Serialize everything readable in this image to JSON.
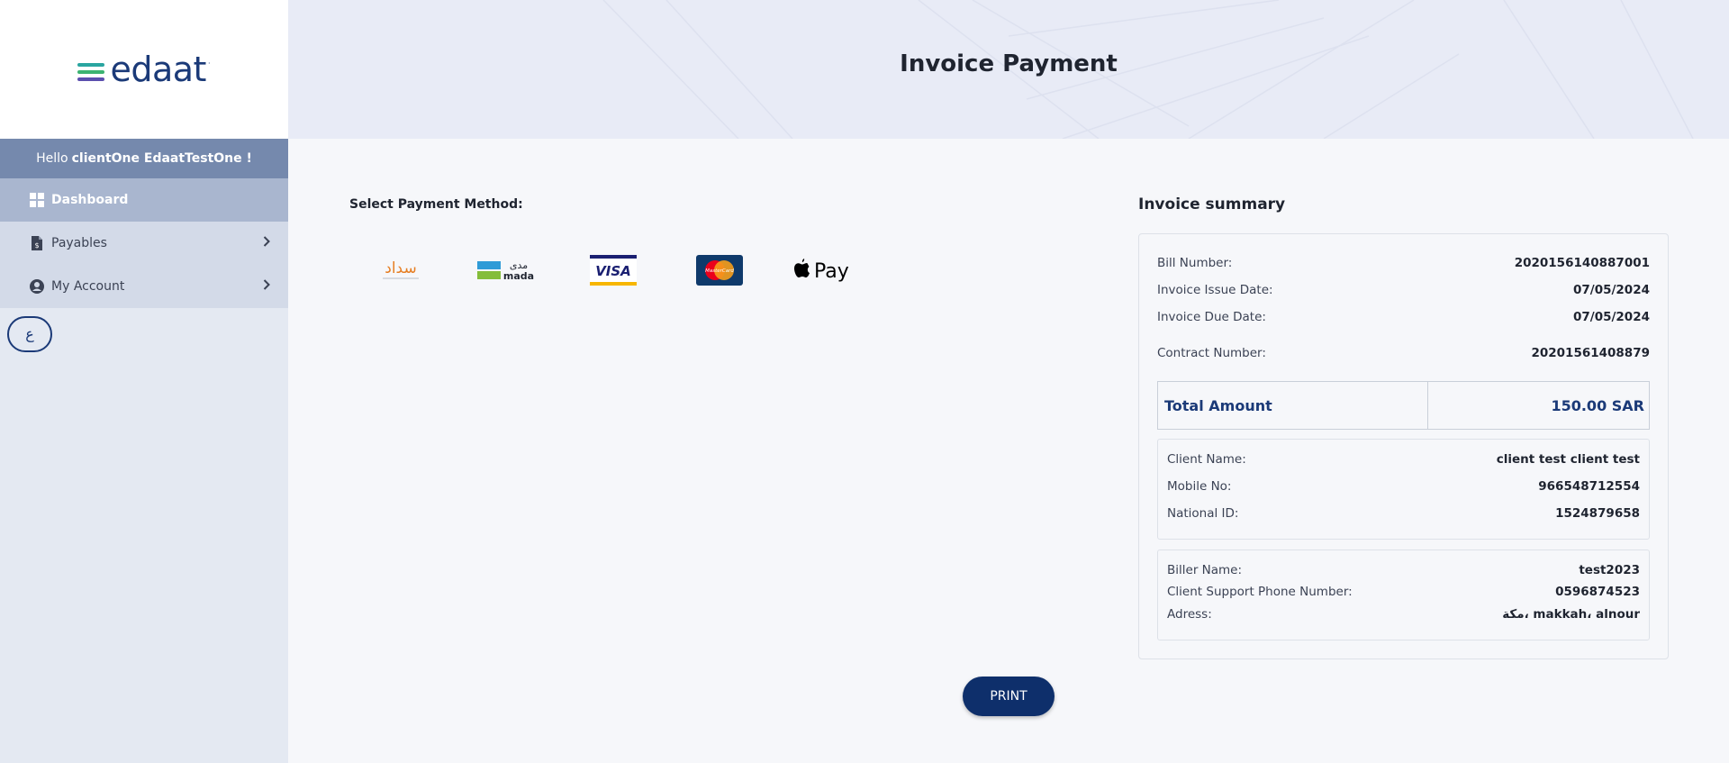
{
  "brand": {
    "logo_text": "edaat",
    "logo_mark": "·",
    "bar_colors": [
      "#2aa5a0",
      "#3cb371",
      "#5b4fae"
    ]
  },
  "sidebar": {
    "hello_prefix": "Hello",
    "user_name": "clientOne EdaatTestOne !",
    "items": [
      {
        "label": "Dashboard",
        "icon": "grid-icon",
        "active": true
      },
      {
        "label": "Payables",
        "icon": "document-dollar-icon",
        "has_submenu": true
      },
      {
        "label": "My Account",
        "icon": "user-circle-icon",
        "has_submenu": true
      }
    ],
    "language_button": "ع"
  },
  "header": {
    "title": "Invoice Payment"
  },
  "payment": {
    "label": "Select Payment Method:",
    "methods": [
      "sadad",
      "mada",
      "VISA",
      "MasterCard",
      "Apple Pay"
    ],
    "sadad_text": "سداد",
    "mada_ar": "مدى",
    "mada_en": "mada",
    "visa_text": "VISA",
    "mastercard_text": "MasterCard",
    "applepay_text": "Pay"
  },
  "summary": {
    "title": "Invoice summary",
    "bill_number_label": "Bill Number:",
    "bill_number": "2020156140887001",
    "issue_date_label": "Invoice Issue Date:",
    "issue_date": "07/05/2024",
    "due_date_label": "Invoice Due Date:",
    "due_date": "07/05/2024",
    "contract_label": "Contract Number:",
    "contract_number": "20201561408879",
    "total_label": "Total Amount",
    "total_value": "150.00 SAR",
    "client": {
      "name_label": "Client Name:",
      "name": "client test client test",
      "mobile_label": "Mobile No:",
      "mobile": "966548712554",
      "national_id_label": "National ID:",
      "national_id": "1524879658"
    },
    "biller": {
      "name_label": "Biller Name:",
      "name": "test2023",
      "support_label": "Client Support Phone Number:",
      "support_phone": "0596874523",
      "address_label": "Adress:",
      "address": "مكة، makkah، alnour"
    }
  },
  "actions": {
    "print_label": "PRINT"
  },
  "colors": {
    "primary": "#0e2f6b",
    "sidebar_bg": "#e4e9f2",
    "header_bg": "#e8ebf6",
    "hello_bg": "#7589ad",
    "active_nav_bg": "#a9b6cf"
  }
}
